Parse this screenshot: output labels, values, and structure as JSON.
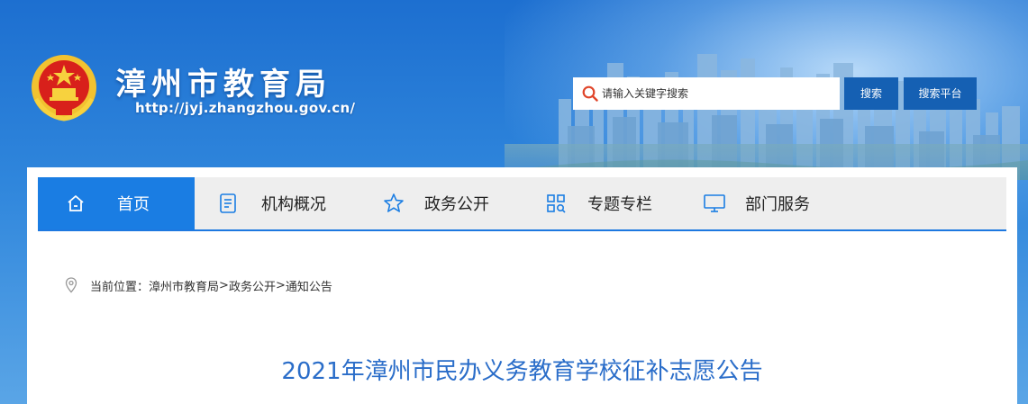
{
  "header": {
    "site_title": "漳州市教育局",
    "site_url": "http://jyj.zhangzhou.gov.cn/",
    "emblem": "national-emblem-icon"
  },
  "search": {
    "placeholder": "请输入关键字搜索",
    "value": "",
    "search_label": "搜索",
    "platform_label": "搜索平台"
  },
  "nav": {
    "items": [
      {
        "label": "首页",
        "icon": "home-icon",
        "active": true
      },
      {
        "label": "机构概况",
        "icon": "document-list-icon",
        "active": false
      },
      {
        "label": "政务公开",
        "icon": "star-icon",
        "active": false
      },
      {
        "label": "专题专栏",
        "icon": "grid-search-icon",
        "active": false
      },
      {
        "label": "部门服务",
        "icon": "monitor-icon",
        "active": false
      }
    ]
  },
  "breadcrumb": {
    "prefix": "当前位置：",
    "items": [
      "漳州市教育局",
      "政务公开",
      "通知公告"
    ],
    "separator": ">"
  },
  "article": {
    "title": "2021年漳州市民办义务教育学校征补志愿公告"
  },
  "colors": {
    "accent": "#1a7de3",
    "title": "#2a6dc9",
    "button": "#1560b3",
    "search_icon": "#e0452a"
  }
}
